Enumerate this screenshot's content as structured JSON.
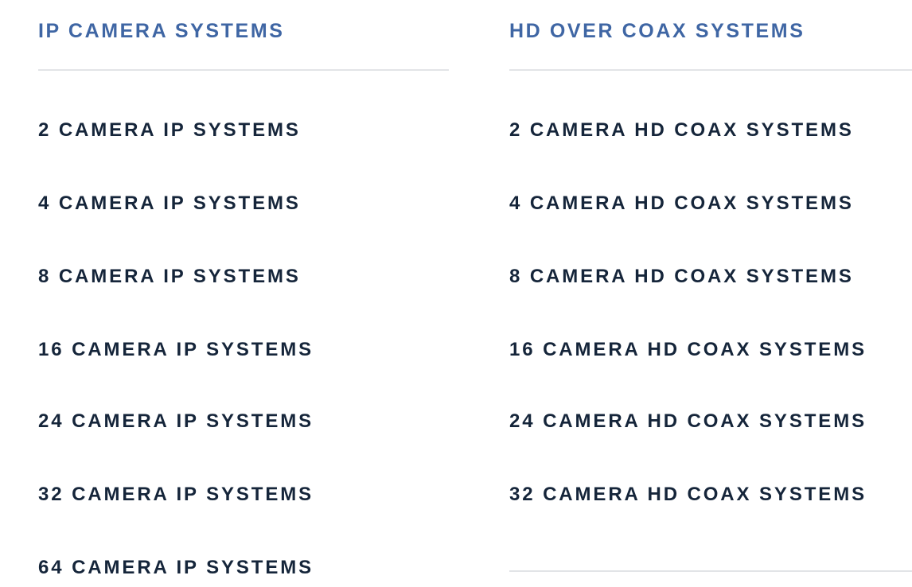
{
  "ip_column": {
    "heading": "IP CAMERA SYSTEMS",
    "items": [
      {
        "label": "2 CAMERA IP SYSTEMS"
      },
      {
        "label": "4 CAMERA IP SYSTEMS"
      },
      {
        "label": "8 CAMERA IP SYSTEMS"
      },
      {
        "label": "16 CAMERA IP SYSTEMS"
      },
      {
        "label": "24 CAMERA IP SYSTEMS"
      },
      {
        "label": "32 CAMERA IP SYSTEMS"
      },
      {
        "label": "64 CAMERA IP SYSTEMS"
      }
    ]
  },
  "coax_column": {
    "heading": "HD OVER COAX SYSTEMS",
    "items": [
      {
        "label": "2 CAMERA HD COAX SYSTEMS"
      },
      {
        "label": "4 CAMERA HD COAX SYSTEMS"
      },
      {
        "label": "8 CAMERA HD COAX SYSTEMS"
      },
      {
        "label": "16 CAMERA HD COAX SYSTEMS"
      },
      {
        "label": "24 CAMERA HD COAX SYSTEMS"
      },
      {
        "label": "32 CAMERA HD COAX SYSTEMS"
      }
    ]
  },
  "colors": {
    "heading": "#3f66a4",
    "link": "#15253a",
    "divider": "#e2e4e7",
    "background": "#ffffff"
  }
}
